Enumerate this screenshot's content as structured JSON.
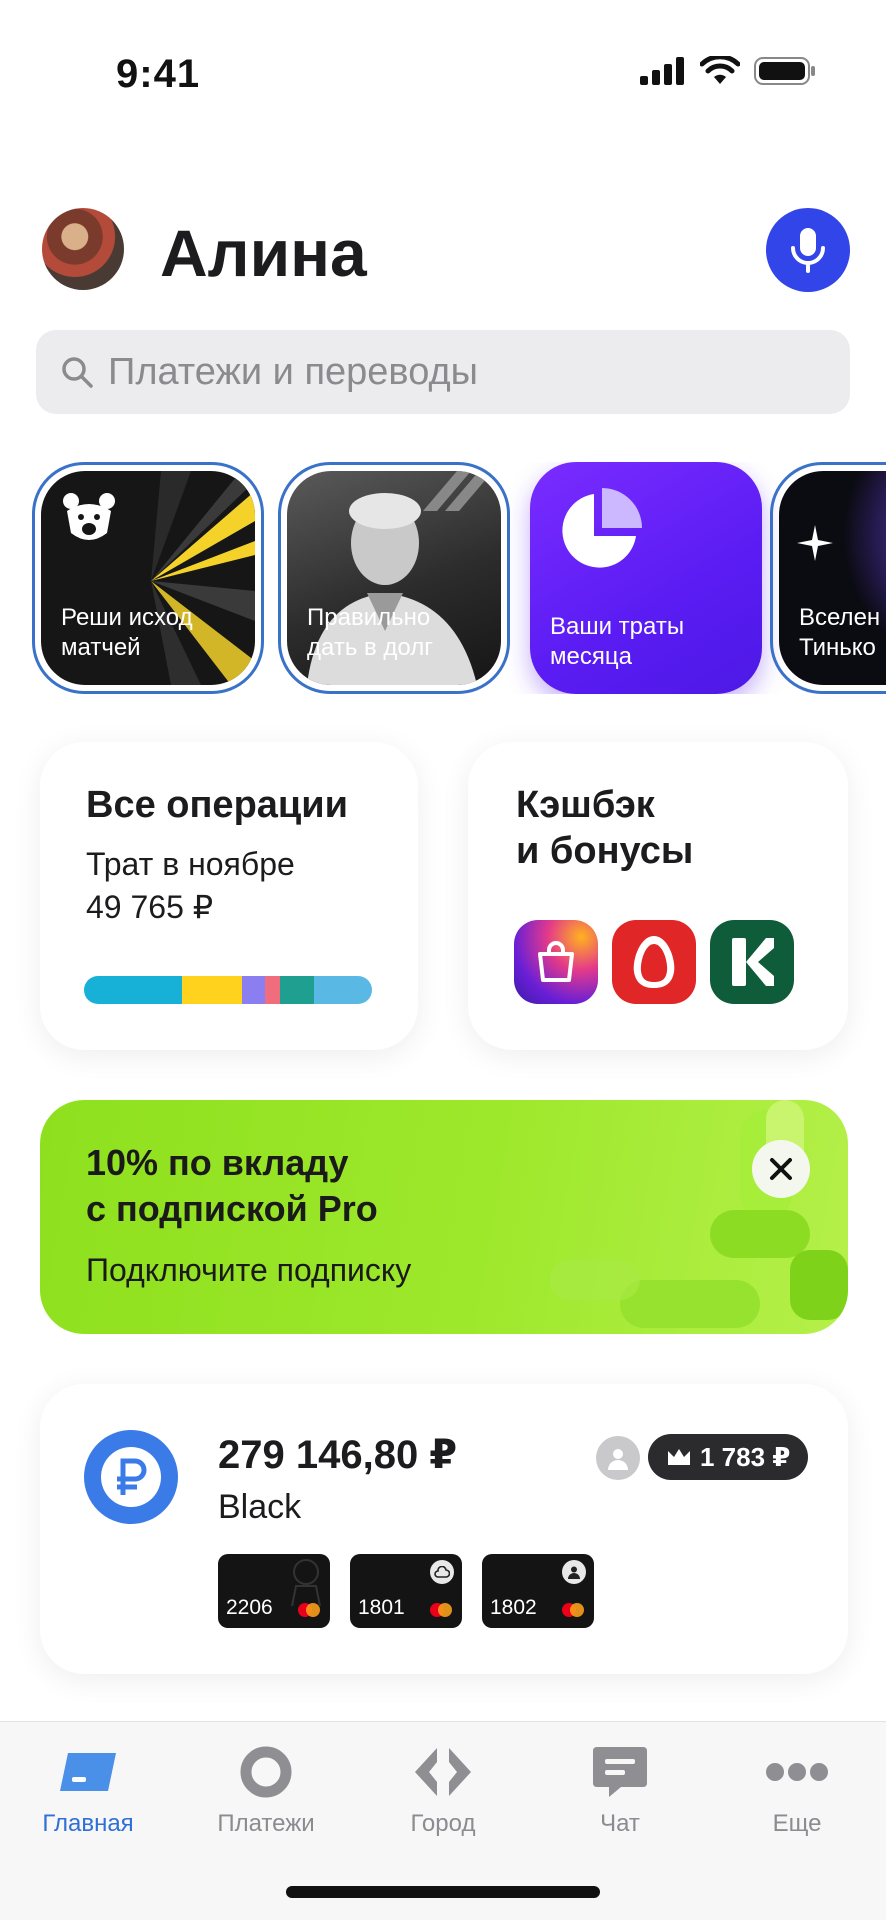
{
  "status": {
    "time": "9:41"
  },
  "header": {
    "user_name": "Алина"
  },
  "search": {
    "placeholder": "Платежи и переводы"
  },
  "stories": [
    {
      "title": "Реши исход\nматчей"
    },
    {
      "title": "Правильно\nдать в долг"
    },
    {
      "title": "Ваши траты\nмесяца"
    },
    {
      "title": "Вселен\nТинько"
    }
  ],
  "operations": {
    "title": "Все операции",
    "subtitle": "Трат в ноябре",
    "amount": "49 765 ₽",
    "segments": [
      {
        "share": 0.34,
        "color": "#17b0d6"
      },
      {
        "share": 0.21,
        "color": "#ffd21e"
      },
      {
        "share": 0.08,
        "color": "#8a7ef0"
      },
      {
        "share": 0.05,
        "color": "#f06d7d"
      },
      {
        "share": 0.12,
        "color": "#1f9f8f"
      },
      {
        "share": 0.2,
        "color": "#5ab8e4"
      }
    ]
  },
  "cashback": {
    "title": "Кэшбэк\nи бонусы",
    "apps": [
      {
        "icon": "shopping-bag-icon",
        "color": "#7b2be0"
      },
      {
        "icon": "egg-icon",
        "color": "#e02626"
      },
      {
        "icon": "k-letter-icon",
        "color": "#0f5c3a"
      }
    ]
  },
  "promo": {
    "title": "10% по вкладу\nс подпиской Pro",
    "subtitle": "Подключите подписку"
  },
  "account": {
    "balance": "279 146,80 ₽",
    "name": "Black",
    "bonus": "1 783 ₽",
    "cards": [
      {
        "number": "2206"
      },
      {
        "number": "1801"
      },
      {
        "number": "1802"
      }
    ]
  },
  "tabs": [
    {
      "label": "Главная",
      "active": true
    },
    {
      "label": "Платежи",
      "active": false
    },
    {
      "label": "Город",
      "active": false
    },
    {
      "label": "Чат",
      "active": false
    },
    {
      "label": "Еще",
      "active": false
    }
  ]
}
